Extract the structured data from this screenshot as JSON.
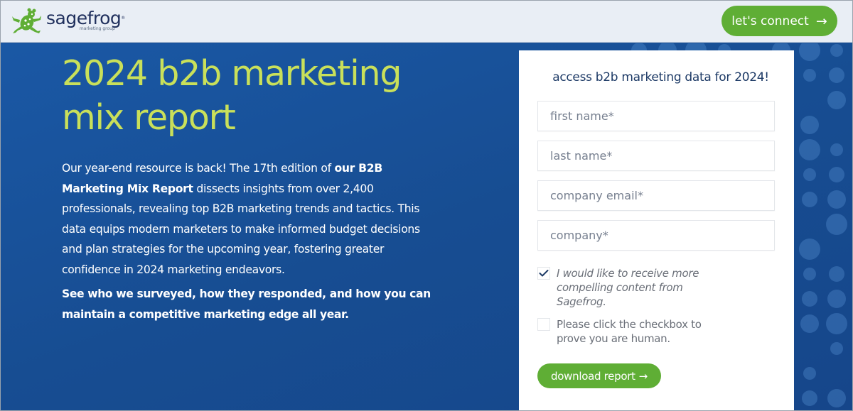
{
  "header": {
    "logo": {
      "name": "sagefrog",
      "registered_mark": "®",
      "tagline": "marketing group",
      "icon": "frog-icon"
    },
    "connect_button": {
      "label": "let's connect",
      "icon": "arrow-right-icon",
      "arrow_glyph": "→"
    }
  },
  "hero": {
    "title_line1": "2024 b2b marketing",
    "title_line2": "mix report",
    "description": {
      "part1": "Our year-end resource is back! The 17th edition of ",
      "bold": "our B2B Marketing Mix Report",
      "part2": " dissects insights from over 2,400 professionals, revealing top B2B marketing trends and tactics. This data equips modern marketers to make informed budget decisions and plan strategies for the upcoming year, fostering greater confidence in 2024 marketing endeavors."
    },
    "callout": "See who we surveyed, how they responded, and how you can maintain a competitive marketing edge all year."
  },
  "form": {
    "heading": "access b2b marketing data for 2024!",
    "fields": [
      {
        "name": "first_name",
        "placeholder": "first name*",
        "value": ""
      },
      {
        "name": "last_name",
        "placeholder": "last name*",
        "value": ""
      },
      {
        "name": "company_email",
        "placeholder": "company email*",
        "value": ""
      },
      {
        "name": "company",
        "placeholder": "company*",
        "value": ""
      }
    ],
    "opt_in": {
      "label": "I would like to receive more compelling content from Sagefrog.",
      "checked": true
    },
    "human_check": {
      "label": "Please click the checkbox to prove you are human.",
      "checked": false
    },
    "submit": {
      "label": "download report",
      "arrow_glyph": "→",
      "icon": "arrow-right-icon"
    }
  },
  "colors": {
    "brand_green": "#5fae35",
    "title_lime": "#c9e05a",
    "hero_blue": "#1a4f96",
    "navy": "#1f2f5c"
  }
}
